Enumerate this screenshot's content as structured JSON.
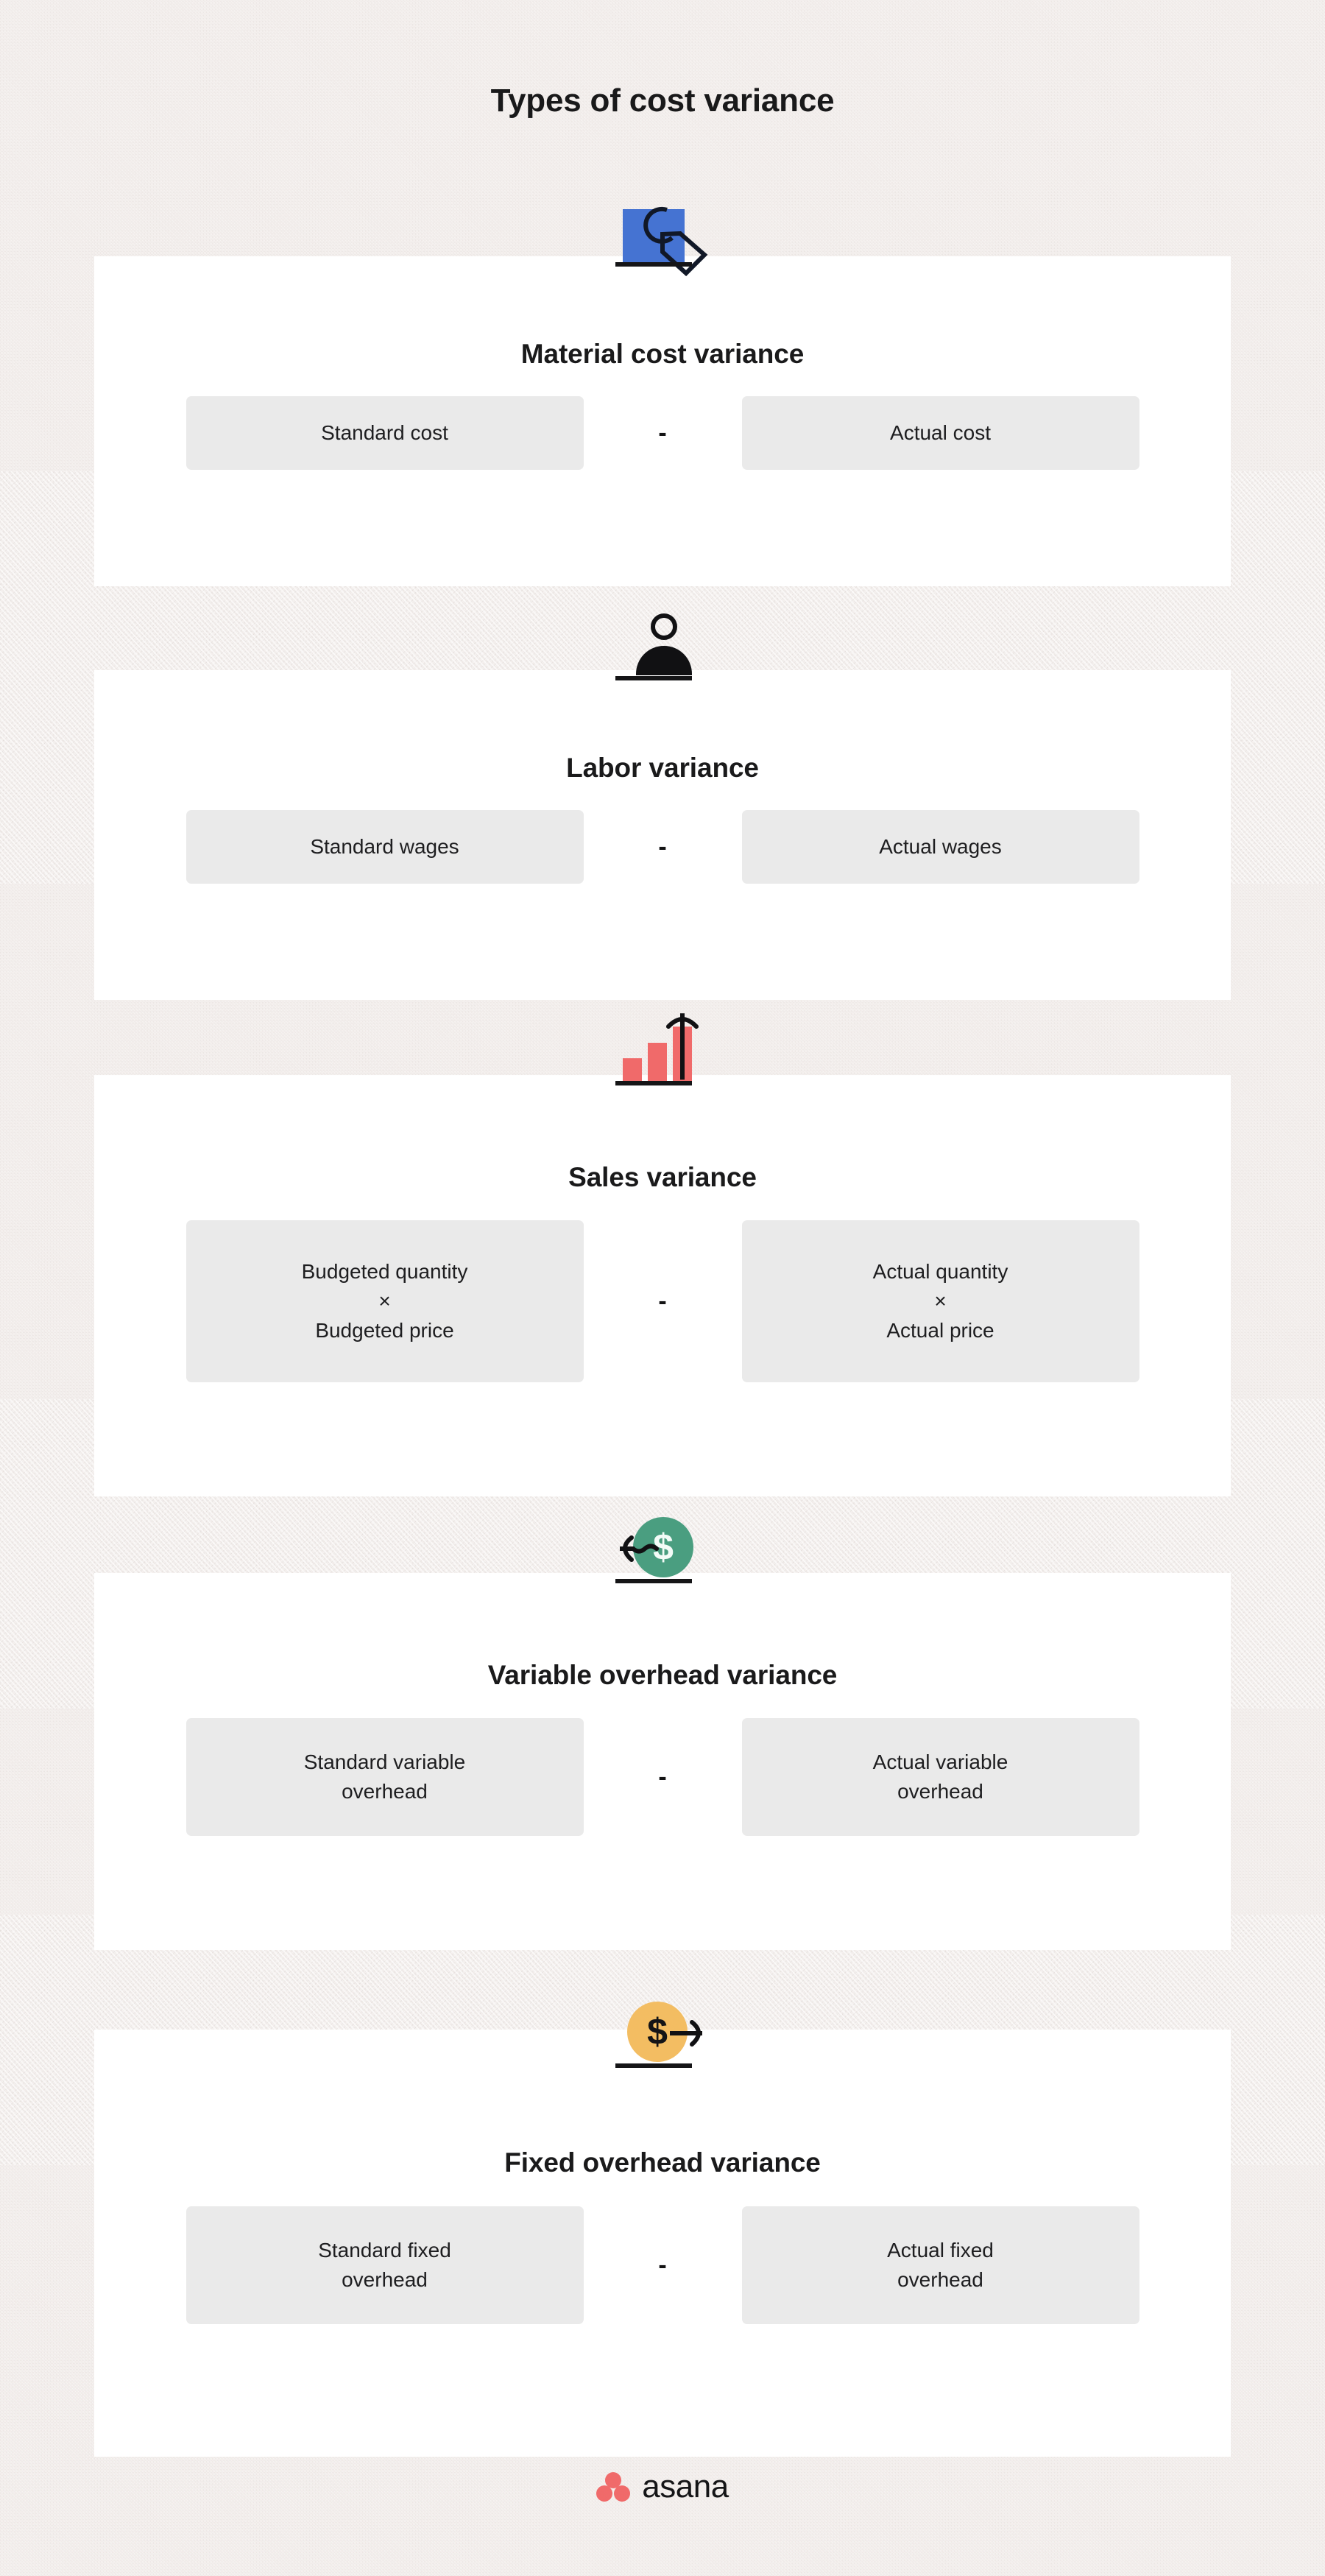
{
  "page": {
    "title": "Types of cost variance",
    "background_color": "#f1ecea",
    "card_color": "#ffffff",
    "term_box_color": "#eaeaea"
  },
  "cards": [
    {
      "title": "Material cost variance",
      "icon": "price-tag-box-icon",
      "icon_color": "#4573d2",
      "operator": "-",
      "left": {
        "lines": [
          "Standard cost"
        ]
      },
      "right": {
        "lines": [
          "Actual cost"
        ]
      }
    },
    {
      "title": "Labor variance",
      "icon": "person-icon",
      "icon_color": "#111113",
      "operator": "-",
      "left": {
        "lines": [
          "Standard wages"
        ]
      },
      "right": {
        "lines": [
          "Actual wages"
        ]
      }
    },
    {
      "title": "Sales variance",
      "icon": "bar-chart-up-icon",
      "icon_color": "#f06a6a",
      "operator": "-",
      "left": {
        "lines": [
          "Budgeted quantity",
          "×",
          "Budgeted price"
        ]
      },
      "right": {
        "lines": [
          "Actual quantity",
          "×",
          "Actual price"
        ]
      }
    },
    {
      "title": "Variable overhead variance",
      "icon": "dollar-coin-left-arrow-icon",
      "icon_color": "#4a9e80",
      "icon_symbol": "$",
      "operator": "-",
      "left": {
        "lines": [
          "Standard variable",
          "overhead"
        ]
      },
      "right": {
        "lines": [
          "Actual variable",
          "overhead"
        ]
      }
    },
    {
      "title": "Fixed overhead variance",
      "icon": "dollar-coin-right-arrow-icon",
      "icon_color": "#f3bd62",
      "icon_symbol": "$",
      "operator": "-",
      "left": {
        "lines": [
          "Standard fixed",
          "overhead"
        ]
      },
      "right": {
        "lines": [
          "Actual fixed",
          "overhead"
        ]
      }
    }
  ],
  "footer": {
    "brand": "asana",
    "brand_color": "#f06a6a"
  }
}
